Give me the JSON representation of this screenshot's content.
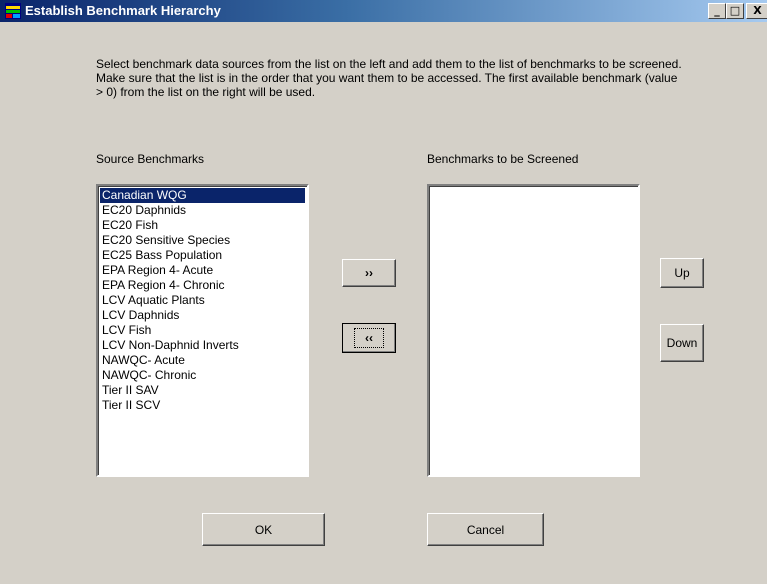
{
  "window": {
    "title": "Establish Benchmark Hierarchy",
    "minimize_glyph": "_",
    "maximize_glyph": "□",
    "close_glyph": "X"
  },
  "instructions": "Select benchmark data sources from the list on the left and add them to the list of benchmarks to be screened.  Make sure that the list is in the order that you want them to be accessed.  The first available benchmark (value > 0) from the list on the right will be used.",
  "source_label": "Source Benchmarks",
  "screened_label": "Benchmarks to be Screened",
  "source_list": {
    "selected_index": 0,
    "items": [
      "Canadian WQG",
      "EC20 Daphnids",
      "EC20 Fish",
      "EC20 Sensitive Species",
      "EC25 Bass Population",
      "EPA Region 4- Acute",
      "EPA Region 4- Chronic",
      "LCV Aquatic Plants",
      "LCV Daphnids",
      "LCV Fish",
      "LCV Non-Daphnid Inverts",
      "NAWQC- Acute",
      "NAWQC- Chronic",
      "Tier II SAV",
      "Tier II SCV"
    ]
  },
  "screened_list": {
    "items": []
  },
  "buttons": {
    "add": "››",
    "remove": "‹‹",
    "up": "Up",
    "down": "Down",
    "ok": "OK",
    "cancel": "Cancel"
  },
  "icon": "app-window-icon"
}
